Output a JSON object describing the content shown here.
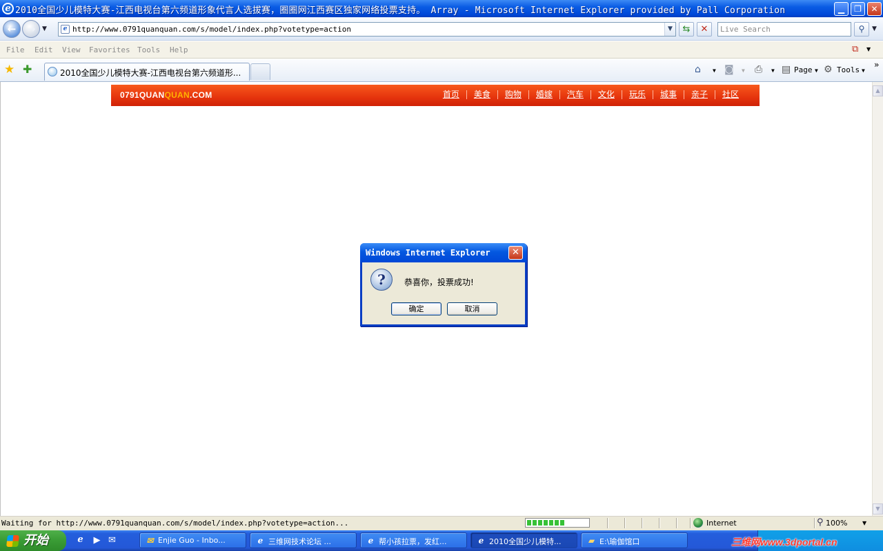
{
  "window": {
    "title": "2010全国少儿模特大赛-江西电视台第六频道形象代言人选拔赛，圈圈网江西赛区独家网络投票支持。 Array - Microsoft Internet Explorer provided by Pall Corporation",
    "minimize_glyph": "▁",
    "restore_glyph": "❐",
    "close_glyph": "✕"
  },
  "address_bar": {
    "url": "http://www.0791quanquan.com/s/model/index.php?votetype=action",
    "search_placeholder": "Live Search"
  },
  "menu": [
    "File",
    "Edit",
    "View",
    "Favorites",
    "Tools",
    "Help"
  ],
  "tabs": {
    "active_title": "2010全国少儿模特大赛-江西电视台第六频道形..."
  },
  "command_bar": {
    "page_label": "Page",
    "tools_label": "Tools"
  },
  "site": {
    "logo_part1": "0791QUAN",
    "logo_part2": "QUAN",
    "logo_part3": ".COM",
    "nav": [
      "首页",
      "美食",
      "购物",
      "婚嫁",
      "汽车",
      "文化",
      "玩乐",
      "城事",
      "亲子",
      "社区"
    ],
    "header_color": "#e5340d",
    "logo_accent_color": "#ffb300"
  },
  "dialog": {
    "title": "Windows Internet Explorer",
    "icon": "question-icon",
    "message": "恭喜你，投票成功!",
    "ok_label": "确定",
    "cancel_label": "取消"
  },
  "status_bar": {
    "text": "Waiting for http://www.0791quanquan.com/s/model/index.php?votetype=action...",
    "progress_percent": 62,
    "zone": "Internet",
    "zoom": "100%"
  },
  "taskbar": {
    "start_label": "开始",
    "tasks": [
      {
        "label": "Enjie Guo - Inbo...",
        "icon": "outlook-icon",
        "active": false
      },
      {
        "label": "三维网技术论坛 ...",
        "icon": "ie-icon",
        "active": false
      },
      {
        "label": "帮小孩拉票，发红...",
        "icon": "ie-icon",
        "active": false
      },
      {
        "label": "2010全国少儿模特...",
        "icon": "ie-icon",
        "active": true
      },
      {
        "label": "E:\\瑜伽馆口",
        "icon": "folder-icon",
        "active": false
      }
    ],
    "watermark": "三维网www.3dportal.cn"
  }
}
